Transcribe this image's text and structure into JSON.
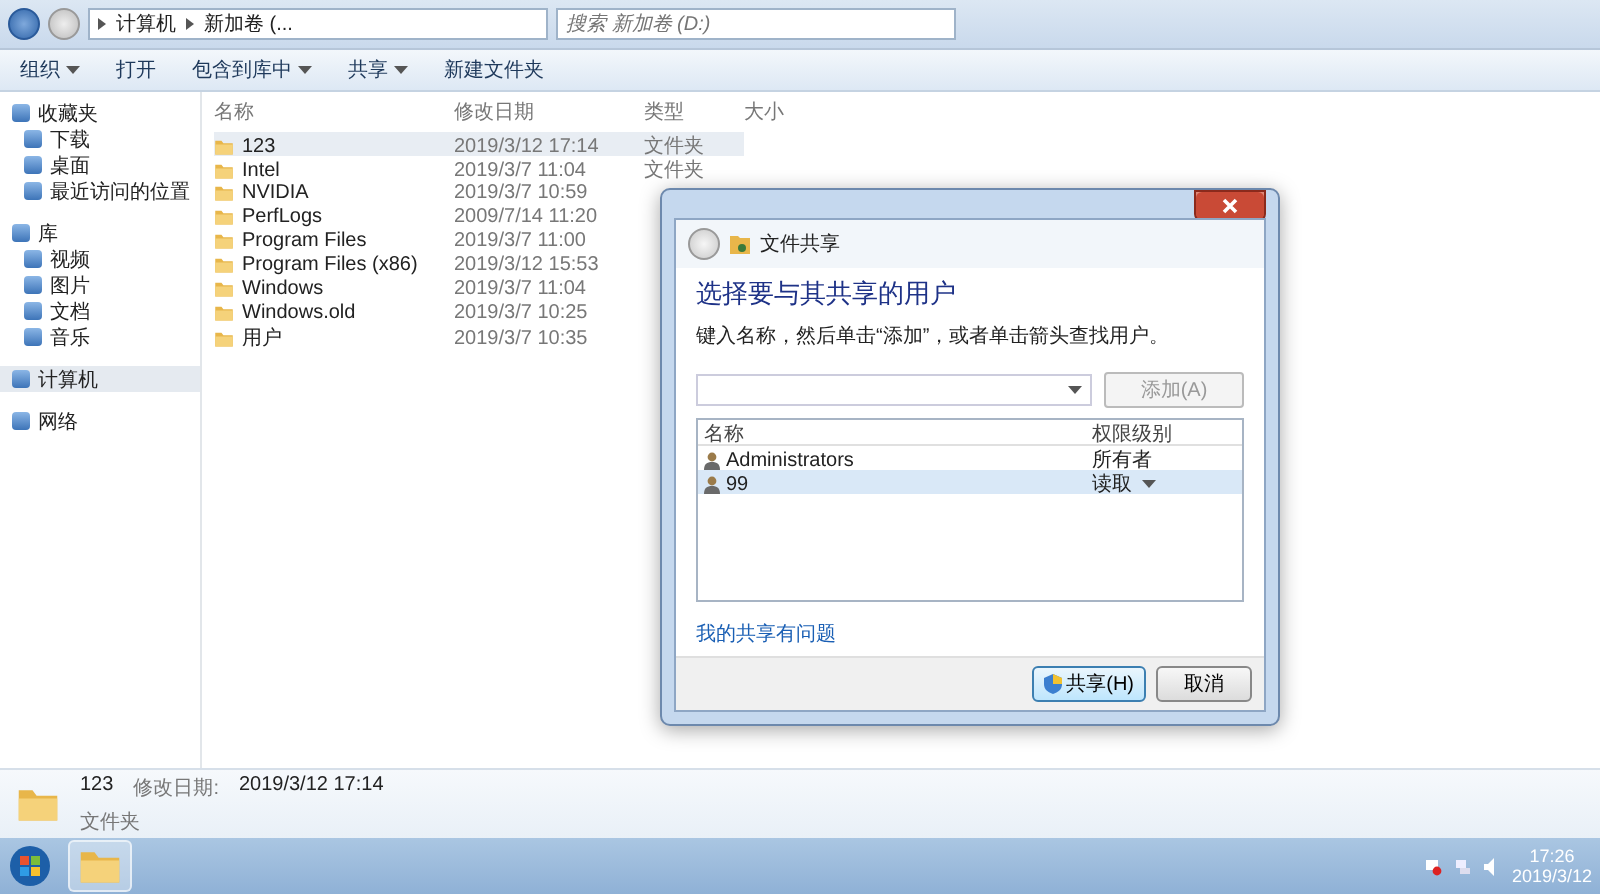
{
  "address_bar": {
    "path": [
      "计算机",
      "新加卷 (..."
    ],
    "search": {
      "placeholder": "搜索 新加卷 (D:)"
    }
  },
  "toolbar": [
    {
      "label": "组织",
      "dropdown": true
    },
    {
      "label": "打开",
      "dropdown": false
    },
    {
      "label": "包含到库中",
      "dropdown": true
    },
    {
      "label": "共享",
      "dropdown": true
    },
    {
      "label": "新建文件夹",
      "dropdown": false
    }
  ],
  "sidebar": {
    "groups": [
      {
        "label": "收藏夹",
        "selected": false,
        "items": [
          {
            "label": "下载"
          },
          {
            "label": "桌面"
          },
          {
            "label": "最近访问的位置"
          }
        ]
      },
      {
        "label": "库",
        "selected": false,
        "items": [
          {
            "label": "视频"
          },
          {
            "label": "图片"
          },
          {
            "label": "文档"
          },
          {
            "label": "音乐"
          }
        ]
      },
      {
        "label": "计算机",
        "selected": true
      },
      {
        "label": "网络",
        "selected": false
      }
    ]
  },
  "file_list": {
    "columns": [
      "名称",
      "修改日期",
      "类型",
      "大小"
    ],
    "rows": [
      {
        "name": "123",
        "modified": "2019/3/12 17:14",
        "type": "文件夹",
        "selected": true
      },
      {
        "name": "Intel",
        "modified": "2019/3/7 11:04",
        "type": "文件夹",
        "selected": false
      },
      {
        "name": "NVIDIA",
        "modified": "2019/3/7 10:59",
        "selected": false
      },
      {
        "name": "PerfLogs",
        "modified": "2009/7/14 11:20",
        "selected": false
      },
      {
        "name": "Program Files",
        "modified": "2019/3/7 11:00",
        "selected": false
      },
      {
        "name": "Program Files (x86)",
        "modified": "2019/3/12 15:53",
        "selected": false
      },
      {
        "name": "Windows",
        "modified": "2019/3/7 11:04",
        "selected": false
      },
      {
        "name": "Windows.old",
        "modified": "2019/3/7 10:25",
        "selected": false
      },
      {
        "name": "用户",
        "modified": "2019/3/7 10:35",
        "selected": false
      }
    ]
  },
  "details_pane": {
    "name": "123",
    "modified_label": "修改日期:",
    "modified": "2019/3/12 17:14",
    "type": "文件夹"
  },
  "dialog": {
    "title": "文件共享",
    "heading": "选择要与其共享的用户",
    "instruction": "键入名称，然后单击“添加”，或者单击箭头查找用户。",
    "add_button": {
      "label": "添加(A)",
      "disabled": true
    },
    "table": {
      "columns": [
        "名称",
        "权限级别"
      ],
      "rows": [
        {
          "name": "Administrators",
          "permission": "所有者",
          "dropdown": false,
          "selected": false
        },
        {
          "name": "99",
          "permission": "读取",
          "dropdown": true,
          "selected": true
        }
      ]
    },
    "help_link": "我的共享有问题",
    "buttons": [
      {
        "label": "共享(H)",
        "kind": "share"
      },
      {
        "label": "取消",
        "kind": "cancel"
      }
    ]
  },
  "taskbar": {
    "time": "17:26",
    "date": "2019/3/12"
  }
}
